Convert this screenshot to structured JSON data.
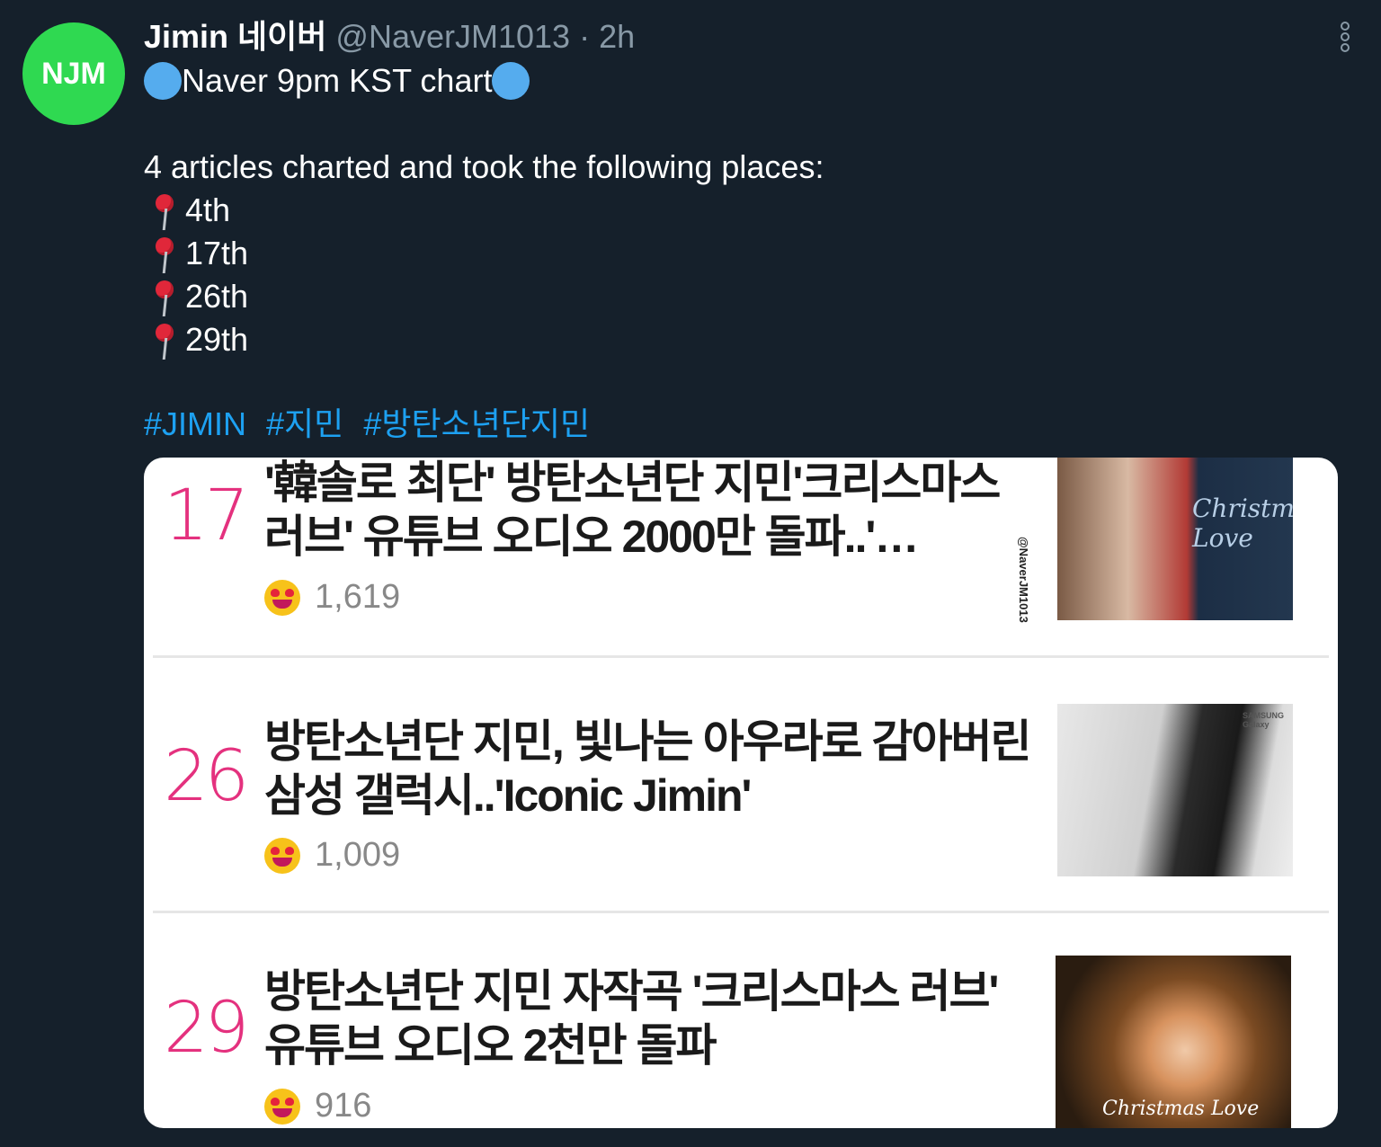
{
  "tweet": {
    "author_name": "Jimin 네이버",
    "handle": "@NaverJM1013",
    "time": "· 2h",
    "avatar_text": "NJM",
    "headline": "Naver 9pm KST chart",
    "intro": "4 articles charted and took the following places:",
    "places": [
      "4th",
      "17th",
      "26th",
      "29th"
    ],
    "hashtags": [
      "#JIMIN",
      "#지민",
      "#방탄소년단지민"
    ]
  },
  "colors": {
    "background": "#15202b",
    "avatar": "#2fd951",
    "hashtag": "#1da1f2",
    "rank": "#e4317e"
  },
  "media": {
    "watermark": "@NaverJM1013",
    "articles": [
      {
        "rank": "17",
        "title": "'韓솔로 최단' 방탄소년단 지민'크리스마스 러브' 유튜브 오디오 2000만 돌파..'…",
        "reactions": "1,619",
        "thumb_text": "Christmas Love"
      },
      {
        "rank": "26",
        "title": "방탄소년단 지민, 빛나는 아우라로 감아버린 삼성 갤럭시..'Iconic Jimin'",
        "reactions": "1,009",
        "thumb_text": "SAMSUNG Galaxy"
      },
      {
        "rank": "29",
        "title": "방탄소년단 지민 자작곡 '크리스마스 러브' 유튜브 오디오 2천만 돌파",
        "reactions": "916",
        "thumb_text": "Christmas Love"
      }
    ]
  }
}
